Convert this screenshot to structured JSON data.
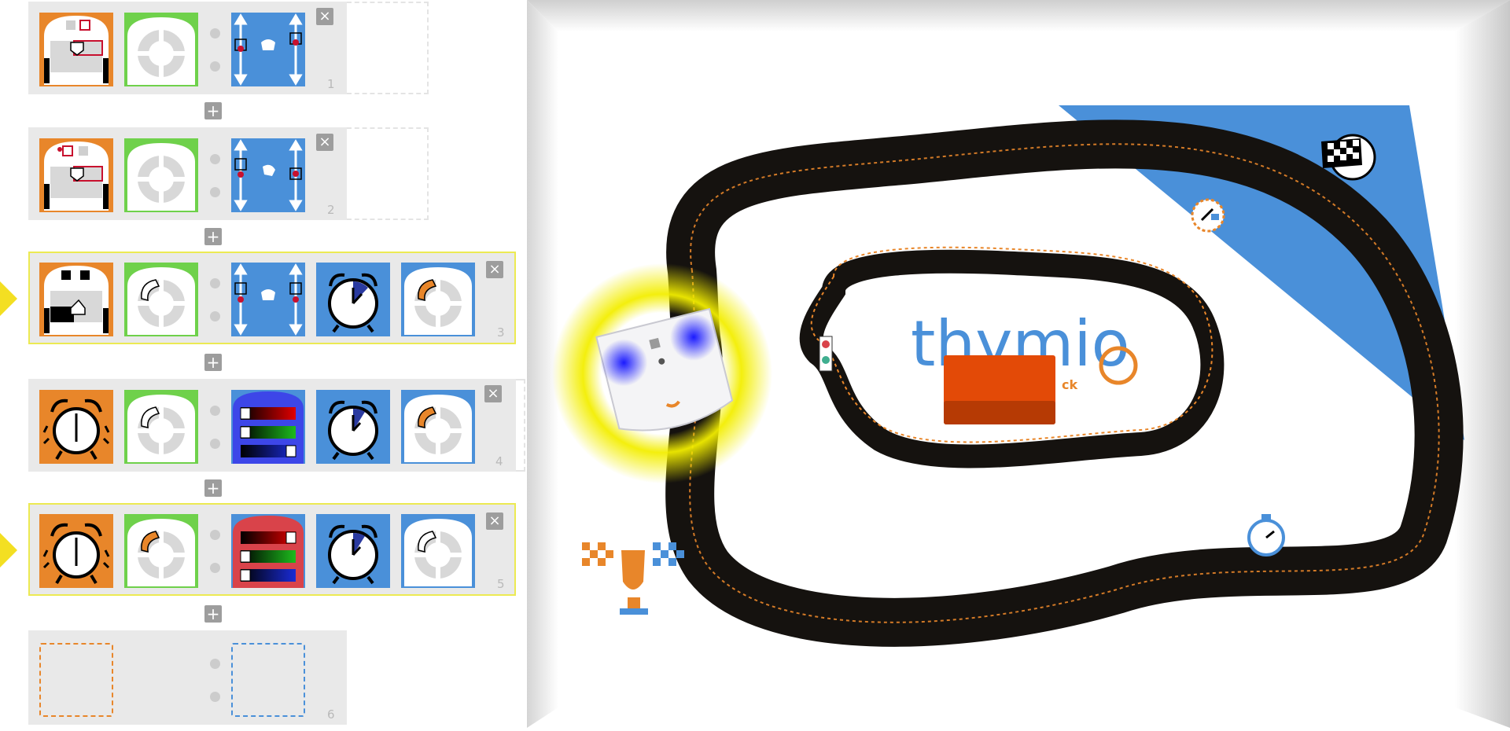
{
  "rows": [
    {
      "number": "1",
      "close_label": "×",
      "active": false
    },
    {
      "number": "2",
      "close_label": "×",
      "active": false
    },
    {
      "number": "3",
      "close_label": "×",
      "active": true
    },
    {
      "number": "4",
      "close_label": "×",
      "active": false
    },
    {
      "number": "5",
      "close_label": "×",
      "active": true
    },
    {
      "number": "6",
      "active": false
    }
  ],
  "add_row_label": "+",
  "arena": {
    "logo_text": "thymio",
    "logo_sub": "ck"
  },
  "colors": {
    "event_orange": "#e8862a",
    "action_blue": "#4a90d9",
    "green": "#6fd14b",
    "track": "#15120f",
    "yellow_highlight": "#f3df22"
  }
}
